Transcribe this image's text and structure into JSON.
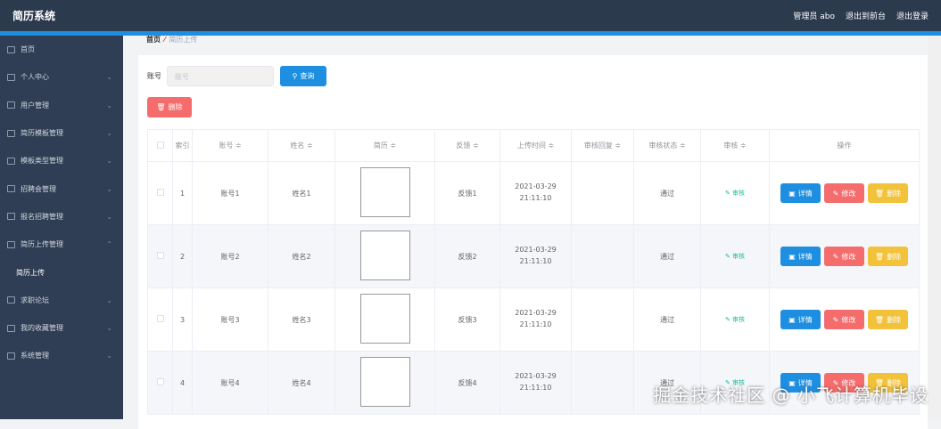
{
  "header": {
    "title": "简历系统",
    "user": "管理员 abo",
    "front": "退出到前台",
    "logout": "退出登录"
  },
  "sidebar": {
    "items": [
      {
        "label": "首页",
        "icon": "home-icon",
        "arrow": false
      },
      {
        "label": "个人中心",
        "icon": "user-icon",
        "arrow": true
      },
      {
        "label": "用户管理",
        "icon": "users-icon",
        "arrow": true
      },
      {
        "label": "简历模板管理",
        "icon": "template-icon",
        "arrow": true
      },
      {
        "label": "模板类型管理",
        "icon": "briefcase-icon",
        "arrow": true
      },
      {
        "label": "招聘会管理",
        "icon": "clipboard-icon",
        "arrow": true
      },
      {
        "label": "报名招聘管理",
        "icon": "signup-icon",
        "arrow": true
      },
      {
        "label": "简历上传管理",
        "icon": "compass-icon",
        "arrow": true,
        "open": true
      },
      {
        "label": "简历上传",
        "sub": true
      },
      {
        "label": "求职论坛",
        "icon": "compass-icon",
        "arrow": true
      },
      {
        "label": "我的收藏管理",
        "icon": "person-icon",
        "arrow": true
      },
      {
        "label": "系统管理",
        "icon": "system-icon",
        "arrow": true
      }
    ]
  },
  "breadcrumb": {
    "home": "首页",
    "current": "简历上传"
  },
  "search": {
    "label": "账号",
    "placeholder": "账号",
    "button": "查询"
  },
  "delete_button": "删除",
  "table": {
    "headers": [
      "索引",
      "账号 ≑",
      "姓名 ≑",
      "简历 ≑",
      "反馈 ≑",
      "上传时间 ≑",
      "审核回复 ≑",
      "审核状态 ≑",
      "审核 ≑",
      "操作"
    ],
    "rows": [
      {
        "index": "1",
        "account": "账号1",
        "name": "姓名1",
        "feedback": "反馈1",
        "time": "2021-03-29 21:11:10",
        "reply": "",
        "status": "通过",
        "audit": "审核"
      },
      {
        "index": "2",
        "account": "账号2",
        "name": "姓名2",
        "feedback": "反馈2",
        "time": "2021-03-29 21:11:10",
        "reply": "",
        "status": "通过",
        "audit": "审核"
      },
      {
        "index": "3",
        "account": "账号3",
        "name": "姓名3",
        "feedback": "反馈3",
        "time": "2021-03-29 21:11:10",
        "reply": "",
        "status": "通过",
        "audit": "审核"
      },
      {
        "index": "4",
        "account": "账号4",
        "name": "姓名4",
        "feedback": "反馈4",
        "time": "2021-03-29 21:11:10",
        "reply": "",
        "status": "通过",
        "audit": "审核"
      }
    ],
    "actions": {
      "detail": "详情",
      "edit": "修改",
      "delete": "删除"
    }
  },
  "watermark": "掘金技术社区 @ 小飞计算机毕设"
}
